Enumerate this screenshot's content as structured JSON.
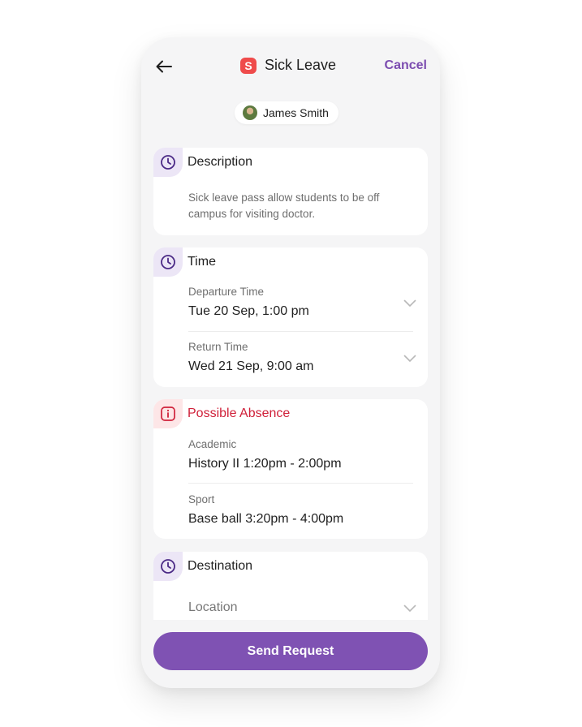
{
  "header": {
    "badge_letter": "S",
    "title": "Sick Leave",
    "cancel_label": "Cancel"
  },
  "user": {
    "name": "James Smith"
  },
  "description_card": {
    "icon": "clock-icon",
    "title": "Description",
    "text": "Sick leave pass allow students to be off campus for visiting doctor."
  },
  "time_card": {
    "icon": "clock-icon",
    "title": "Time",
    "departure_label": "Departure Time",
    "departure_value": "Tue 20 Sep, 1:00 pm",
    "return_label": "Return Time",
    "return_value": "Wed 21 Sep, 9:00 am"
  },
  "absence_card": {
    "icon": "info-icon",
    "title": "Possible Absence",
    "academic_label": "Academic",
    "academic_value": "History II 1:20pm - 2:00pm",
    "sport_label": "Sport",
    "sport_value": "Base ball 3:20pm - 4:00pm"
  },
  "destination_card": {
    "icon": "clock-icon",
    "title": "Destination",
    "location_placeholder": "Location"
  },
  "send_button_label": "Send Request",
  "colors": {
    "accent": "#7f52b3",
    "cancel": "#7c4db0",
    "alert": "#d0213a",
    "badge": "#ef4b4b",
    "background": "#f5f5f6"
  }
}
